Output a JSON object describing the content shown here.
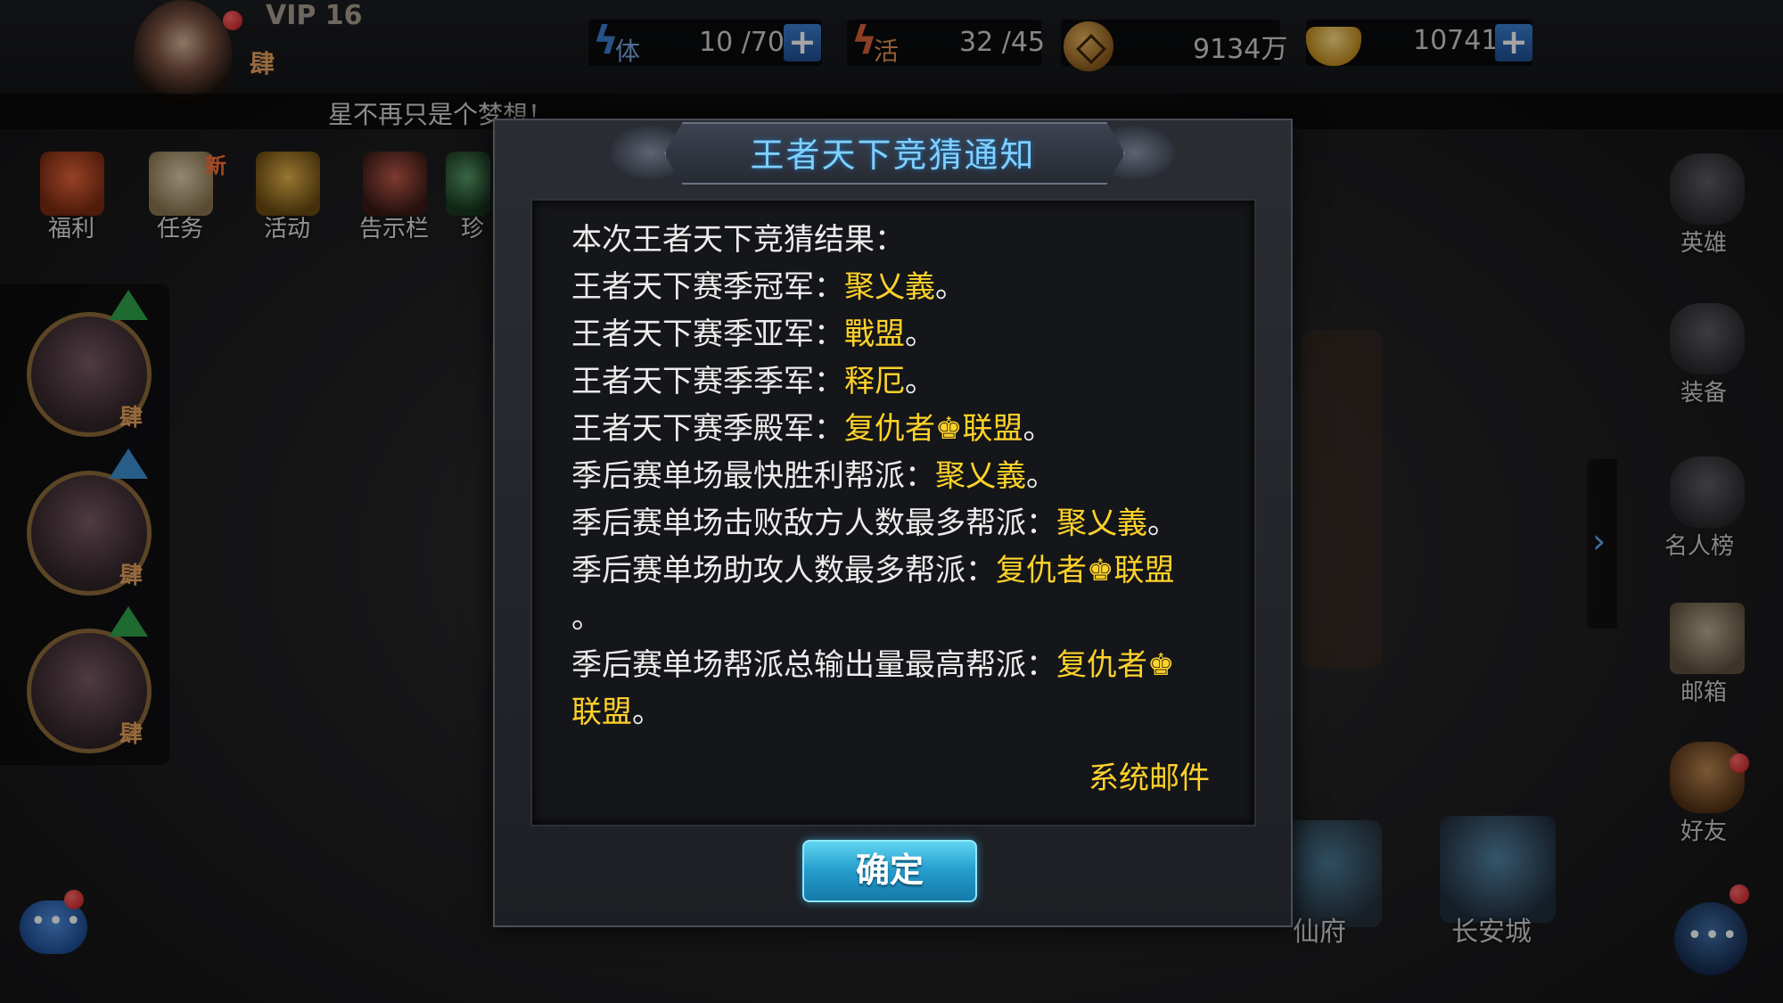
{
  "topbar": {
    "vip": "VIP 16",
    "rank_glyph": "肆",
    "stamina": {
      "label": "体",
      "value": "10 /70"
    },
    "vitality": {
      "label": "活",
      "value": "32 /45"
    },
    "coins": {
      "value": "9134万"
    },
    "gold": {
      "value": "10741"
    },
    "plus": "+"
  },
  "ticker": {
    "text": "星不再只是个梦想！"
  },
  "left_menu": [
    {
      "label": "福利"
    },
    {
      "label": "任务",
      "badge": "新"
    },
    {
      "label": "活动"
    },
    {
      "label": "告示栏"
    },
    {
      "label": "珍"
    }
  ],
  "heroes": [
    {
      "rank": "肆"
    },
    {
      "rank": "肆"
    },
    {
      "rank": "肆"
    }
  ],
  "right_menu": [
    {
      "label": "英雄"
    },
    {
      "label": "装备"
    },
    {
      "label": "名人榜"
    },
    {
      "label": "邮箱"
    },
    {
      "label": "好友"
    }
  ],
  "bottom": {
    "xianfu": "仙府",
    "changan": "长安城"
  },
  "dialog": {
    "title": "王者天下竞猜通知",
    "lines": [
      {
        "prefix": "本次王者天下竞猜结果：",
        "value": "",
        "suffix": ""
      },
      {
        "prefix": "王者天下赛季冠军：",
        "value": "聚乂義",
        "suffix": "。"
      },
      {
        "prefix": "王者天下赛季亚军：",
        "value": "戰盟",
        "suffix": "。"
      },
      {
        "prefix": "王者天下赛季季军：",
        "value": "释厄",
        "suffix": "。"
      },
      {
        "prefix": "王者天下赛季殿军：",
        "value": "复仇者♚联盟",
        "suffix": "。"
      },
      {
        "prefix": "季后赛单场最快胜利帮派：",
        "value": "聚乂義",
        "suffix": "。"
      },
      {
        "prefix": "季后赛单场击败敌方人数最多帮派：",
        "value": "聚乂義",
        "suffix": "。"
      },
      {
        "prefix": "季后赛单场助攻人数最多帮派：",
        "value": "复仇者♚联盟",
        "suffix": ""
      },
      {
        "prefix": "。",
        "value": "",
        "suffix": ""
      },
      {
        "prefix": "季后赛单场帮派总输出量最高帮派：",
        "value": "复仇者♚",
        "suffix": ""
      },
      {
        "prefix": "",
        "value": "联盟",
        "suffix": "。"
      }
    ],
    "signature": "系统邮件",
    "ok": "确定"
  },
  "colors": {
    "highlight": "#ffd22a",
    "title": "#7fd0ff",
    "button": "#249ccd"
  }
}
